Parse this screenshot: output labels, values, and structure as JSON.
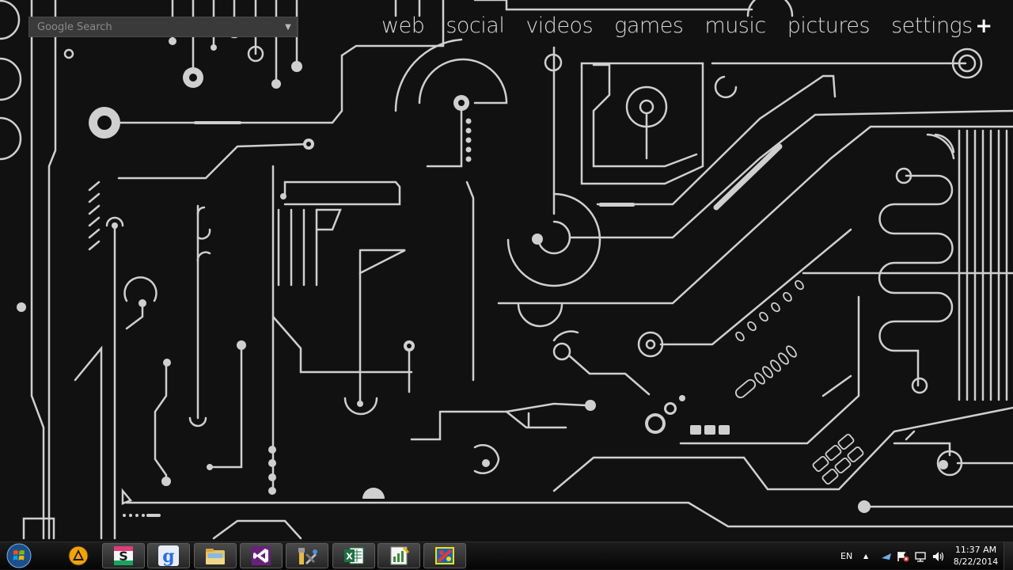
{
  "search": {
    "placeholder": "Google Search",
    "value": ""
  },
  "nav": {
    "items": [
      "web",
      "social",
      "videos",
      "games",
      "music",
      "pictures",
      "settings"
    ],
    "plus_label": "+"
  },
  "taskbar": {
    "apps": [
      {
        "name": "start-orb-icon"
      },
      {
        "name": "vlc-player-icon"
      },
      {
        "name": "sheets-s-icon"
      },
      {
        "name": "google-icon"
      },
      {
        "name": "windows-explorer-icon"
      },
      {
        "name": "visual-studio-icon"
      },
      {
        "name": "tools-icon"
      },
      {
        "name": "excel-icon"
      },
      {
        "name": "chart-app-icon"
      },
      {
        "name": "paint-icon"
      }
    ],
    "language": "EN",
    "time": "11:37 AM",
    "date": "8/22/2014"
  },
  "colors": {
    "background": "#111111",
    "circuit": "#cfcfcf",
    "taskbar": "#0a0a0a"
  }
}
